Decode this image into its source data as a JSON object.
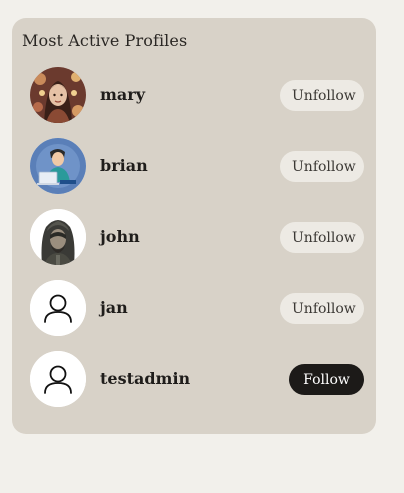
{
  "panel": {
    "title": "Most Active Profiles"
  },
  "profiles": [
    {
      "username": "mary",
      "action_label": "Unfollow",
      "avatar_icon": "portrait-woman-avatar"
    },
    {
      "username": "brian",
      "action_label": "Unfollow",
      "avatar_icon": "person-at-laptop-avatar"
    },
    {
      "username": "john",
      "action_label": "Unfollow",
      "avatar_icon": "hooded-man-avatar"
    },
    {
      "username": "jan",
      "action_label": "Unfollow",
      "avatar_icon": "default-user-icon"
    },
    {
      "username": "testadmin",
      "action_label": "Follow",
      "avatar_icon": "default-user-icon"
    }
  ],
  "colors": {
    "page_background": "#f2f0eb",
    "panel_background": "#d8d2c8",
    "unfollow_button": "#edeae4",
    "follow_button": "#1c1a18"
  }
}
